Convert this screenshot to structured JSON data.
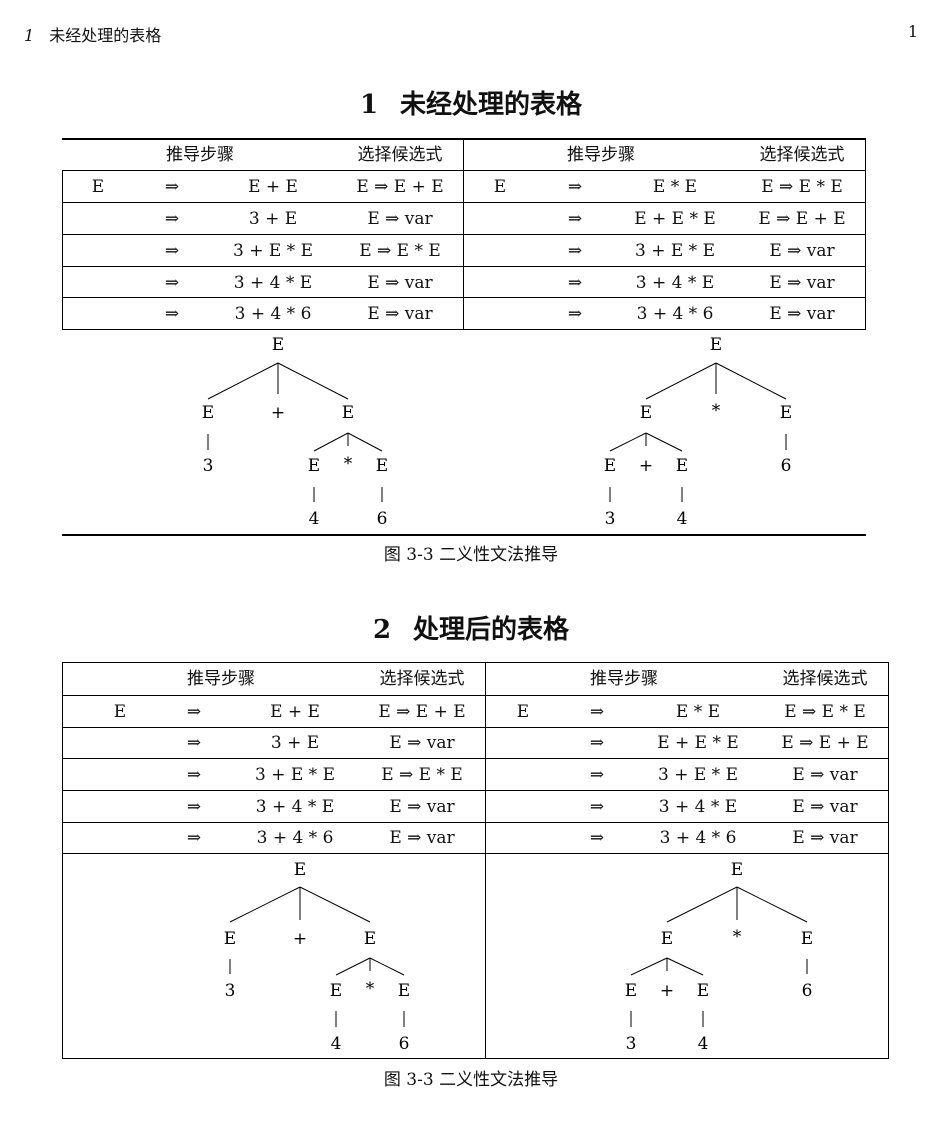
{
  "running_head": {
    "number": "1",
    "title": "未经处理的表格",
    "page": "1"
  },
  "sections": [
    {
      "number": "1",
      "title": "未经处理的表格",
      "caption": "图 3-3 二义性文法推导"
    },
    {
      "number": "2",
      "title": "处理后的表格",
      "caption": "图 3-3 二义性文法推导"
    }
  ],
  "table": {
    "header": {
      "steps": "推导步骤",
      "choice": "选择候选式"
    },
    "left_rows": [
      [
        "E",
        "⇒",
        "E + E",
        "E ⇒ E + E"
      ],
      [
        "",
        "⇒",
        "3 + E",
        "E ⇒ var"
      ],
      [
        "",
        "⇒",
        "3 + E * E",
        "E ⇒ E * E"
      ],
      [
        "",
        "⇒",
        "3 + 4 * E",
        "E ⇒ var"
      ],
      [
        "",
        "⇒",
        "3 + 4 * 6",
        "E ⇒ var"
      ]
    ],
    "right_rows": [
      [
        "E",
        "⇒",
        "E * E",
        "E ⇒ E * E"
      ],
      [
        "",
        "⇒",
        "E + E * E",
        "E ⇒ E + E"
      ],
      [
        "",
        "⇒",
        "3 + E * E",
        "E ⇒ var"
      ],
      [
        "",
        "⇒",
        "3 + 4 * E",
        "E ⇒ var"
      ],
      [
        "",
        "⇒",
        "3 + 4 * 6",
        "E ⇒ var"
      ]
    ]
  },
  "trees": {
    "left": {
      "root": "E",
      "level1": [
        "E",
        "+",
        "E"
      ],
      "level2_left": "3",
      "level2_right": [
        "E",
        "*",
        "E"
      ],
      "level3": [
        "4",
        "6"
      ]
    },
    "right": {
      "root": "E",
      "level1": [
        "E",
        "*",
        "E"
      ],
      "level2_left": [
        "E",
        "+",
        "E"
      ],
      "level2_right": "6",
      "level3": [
        "3",
        "4"
      ]
    }
  }
}
